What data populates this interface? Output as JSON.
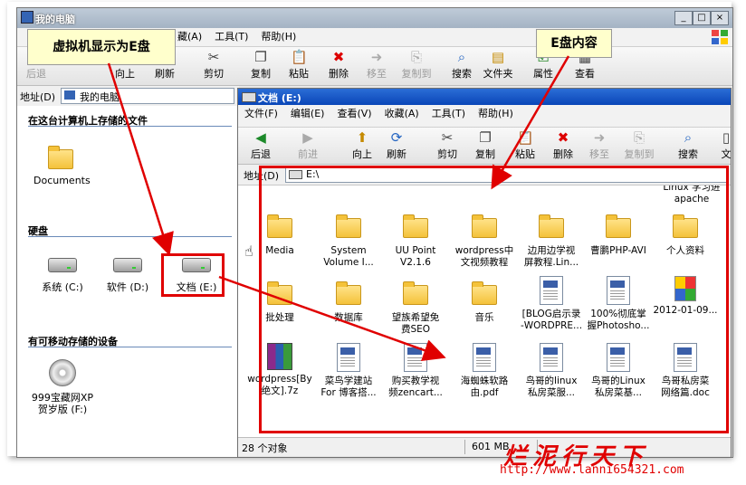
{
  "outer_window": {
    "title": "我的电脑",
    "menu": [
      "藏(A)",
      "工具(T)",
      "帮助(H)"
    ],
    "toolbar": [
      {
        "icon": "back-icon",
        "label": "后退",
        "disabled": true
      },
      {
        "icon": "forward-icon",
        "label": "",
        "disabled": true
      },
      {
        "icon": "up-icon",
        "label": "向上",
        "disabled": false
      },
      {
        "icon": "refresh-icon",
        "label": "刷新",
        "disabled": false
      },
      {
        "icon": "cut-icon",
        "label": "剪切",
        "disabled": false
      },
      {
        "icon": "copy-icon",
        "label": "复制",
        "disabled": false
      },
      {
        "icon": "paste-icon",
        "label": "粘贴",
        "disabled": false
      },
      {
        "icon": "delete-icon",
        "label": "删除",
        "disabled": false
      },
      {
        "icon": "move-icon",
        "label": "移至",
        "disabled": true
      },
      {
        "icon": "copyto-icon",
        "label": "复制到",
        "disabled": true
      },
      {
        "icon": "search-icon",
        "label": "搜索",
        "disabled": false
      },
      {
        "icon": "folders-icon",
        "label": "文件夹",
        "disabled": false
      },
      {
        "icon": "properties-icon",
        "label": "属性",
        "disabled": false
      },
      {
        "icon": "view-icon",
        "label": "查看",
        "disabled": false
      }
    ],
    "address_label": "地址(D)",
    "address_value": "我的电脑",
    "section_files": "在这台计算机上存储的文件",
    "documents_label": "Documents",
    "section_disks": "硬盘",
    "drives": [
      "系统 (C:)",
      "软件 (D:)",
      "文档 (E:)"
    ],
    "section_removable": "有可移动存储的设备",
    "removable": "999宝藏网XP\n贺岁版 (F:)"
  },
  "inner_window": {
    "title": "文档 (E:)",
    "menu": [
      "文件(F)",
      "编辑(E)",
      "查看(V)",
      "收藏(A)",
      "工具(T)",
      "帮助(H)"
    ],
    "toolbar": [
      {
        "icon": "back-icon",
        "label": "后退",
        "disabled": false
      },
      {
        "icon": "forward-icon",
        "label": "前进",
        "disabled": true
      },
      {
        "icon": "up-icon",
        "label": "向上",
        "disabled": false
      },
      {
        "icon": "refresh-icon",
        "label": "刷新",
        "disabled": false
      },
      {
        "icon": "cut-icon",
        "label": "剪切",
        "disabled": false
      },
      {
        "icon": "copy-icon",
        "label": "复制",
        "disabled": false
      },
      {
        "icon": "paste-icon",
        "label": "粘贴",
        "disabled": false
      },
      {
        "icon": "delete-icon",
        "label": "删除",
        "disabled": false
      },
      {
        "icon": "move-icon",
        "label": "移至",
        "disabled": true
      },
      {
        "icon": "copyto-icon",
        "label": "复制到",
        "disabled": true
      },
      {
        "icon": "search-icon",
        "label": "搜索",
        "disabled": false
      },
      {
        "icon": "file-icon",
        "label": "文",
        "disabled": false
      }
    ],
    "address_label": "地址(D)",
    "address_value": "E:\\",
    "top_row_partial": [
      "",
      "",
      "",
      "",
      "",
      "",
      "Linux 学习进\napache"
    ],
    "items": [
      {
        "type": "folder",
        "label": "Media"
      },
      {
        "type": "folder",
        "label": "System\nVolume I..."
      },
      {
        "type": "folder",
        "label": "UU Point\nV2.1.6"
      },
      {
        "type": "folder",
        "label": "wordpress中\n文视频教程"
      },
      {
        "type": "folder",
        "label": "边用边学视\n屏教程.Lin..."
      },
      {
        "type": "folder",
        "label": "曹鹏PHP-AVI"
      },
      {
        "type": "folder",
        "label": "个人资料"
      },
      {
        "type": "folder",
        "label": "批处理"
      },
      {
        "type": "folder",
        "label": "数据库"
      },
      {
        "type": "folder",
        "label": "望族希望免\n费SEO"
      },
      {
        "type": "folder",
        "label": "音乐"
      },
      {
        "type": "doc",
        "label": "[BLOG启示录\n-WORDPRE..."
      },
      {
        "type": "doc",
        "label": "100%彻底掌\n握Photosho..."
      },
      {
        "type": "image",
        "label": "2012-01-09..."
      },
      {
        "type": "rar",
        "label": "wordpress[By\n绝文].7z"
      },
      {
        "type": "doc",
        "label": "菜鸟学建站\nFor 博客搭..."
      },
      {
        "type": "doc",
        "label": "购买教学视\n频zencart..."
      },
      {
        "type": "doc",
        "label": "海蜘蛛软路\n由.pdf"
      },
      {
        "type": "doc",
        "label": "鸟哥的linux\n私房菜服..."
      },
      {
        "type": "doc",
        "label": "鸟哥的Linux\n私房菜基..."
      },
      {
        "type": "doc",
        "label": "鸟哥私房菜\n网络篇.doc"
      }
    ],
    "status_count": "28 个对象",
    "status_size": "601 MB"
  },
  "annotations": {
    "callout_left": "虚拟机显示为E盘",
    "callout_right": "E盘内容",
    "annotation_color": "#e00000"
  },
  "watermark": {
    "text": "烂泥行天下",
    "url": "http://www.lanni654321.com"
  }
}
